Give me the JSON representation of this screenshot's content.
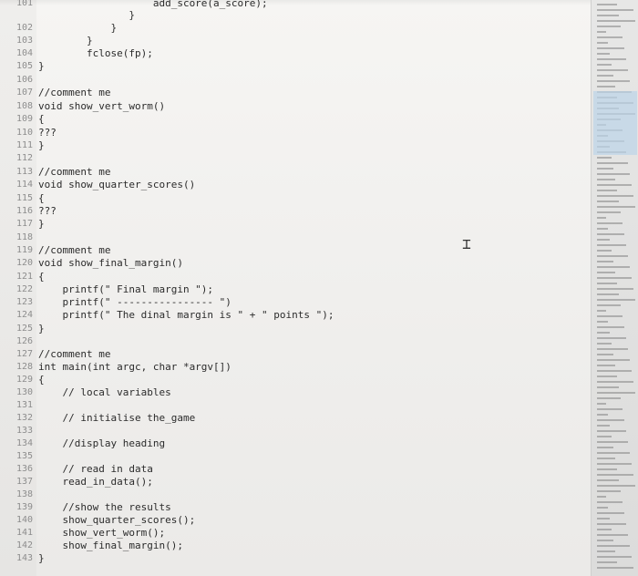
{
  "editor": {
    "lines": [
      {
        "n": "101",
        "text": "                   add_score(a_score);",
        "indent": 0
      },
      {
        "n": "",
        "text": "               }",
        "indent": 0
      },
      {
        "n": "102",
        "text": "            }",
        "indent": 0
      },
      {
        "n": "103",
        "text": "        }",
        "indent": 0
      },
      {
        "n": "104",
        "text": "        fclose(fp);",
        "indent": 0
      },
      {
        "n": "105",
        "text": "}",
        "indent": 0
      },
      {
        "n": "106",
        "text": "",
        "indent": 0
      },
      {
        "n": "107",
        "text": "//comment me",
        "indent": 0
      },
      {
        "n": "108",
        "text": "void show_vert_worm()",
        "indent": 0
      },
      {
        "n": "109",
        "text": "{",
        "indent": 0
      },
      {
        "n": "110",
        "text": "???",
        "indent": 0
      },
      {
        "n": "111",
        "text": "}",
        "indent": 0
      },
      {
        "n": "112",
        "text": "",
        "indent": 0
      },
      {
        "n": "113",
        "text": "//comment me",
        "indent": 0
      },
      {
        "n": "114",
        "text": "void show_quarter_scores()",
        "indent": 0
      },
      {
        "n": "115",
        "text": "{",
        "indent": 0
      },
      {
        "n": "116",
        "text": "???",
        "indent": 0
      },
      {
        "n": "117",
        "text": "}",
        "indent": 0
      },
      {
        "n": "118",
        "text": "",
        "indent": 0
      },
      {
        "n": "119",
        "text": "//comment me",
        "indent": 0
      },
      {
        "n": "120",
        "text": "void show_final_margin()",
        "indent": 0
      },
      {
        "n": "121",
        "text": "{",
        "indent": 0
      },
      {
        "n": "122",
        "text": "    printf(\" Final margin \");",
        "indent": 0
      },
      {
        "n": "123",
        "text": "    printf(\" ---------------- \")",
        "indent": 0
      },
      {
        "n": "124",
        "text": "    printf(\" The dinal margin is \" + \" points \");",
        "indent": 0
      },
      {
        "n": "125",
        "text": "}",
        "indent": 0
      },
      {
        "n": "126",
        "text": "",
        "indent": 0
      },
      {
        "n": "127",
        "text": "//comment me",
        "indent": 0
      },
      {
        "n": "128",
        "text": "int main(int argc, char *argv[])",
        "indent": 0
      },
      {
        "n": "129",
        "text": "{",
        "indent": 0
      },
      {
        "n": "130",
        "text": "    // local variables",
        "indent": 0
      },
      {
        "n": "131",
        "text": "",
        "indent": 0
      },
      {
        "n": "132",
        "text": "    // initialise the_game",
        "indent": 0
      },
      {
        "n": "133",
        "text": "",
        "indent": 0
      },
      {
        "n": "134",
        "text": "    //display heading",
        "indent": 0
      },
      {
        "n": "135",
        "text": "",
        "indent": 0
      },
      {
        "n": "136",
        "text": "    // read in data",
        "indent": 0
      },
      {
        "n": "137",
        "text": "    read_in_data();",
        "indent": 0
      },
      {
        "n": "138",
        "text": "",
        "indent": 0
      },
      {
        "n": "139",
        "text": "    //show the results",
        "indent": 0
      },
      {
        "n": "140",
        "text": "    show_quarter_scores();",
        "indent": 0
      },
      {
        "n": "141",
        "text": "    show_vert_worm();",
        "indent": 0
      },
      {
        "n": "142",
        "text": "    show_final_margin();",
        "indent": 0
      },
      {
        "n": "143",
        "text": "}",
        "indent": 0
      }
    ]
  }
}
